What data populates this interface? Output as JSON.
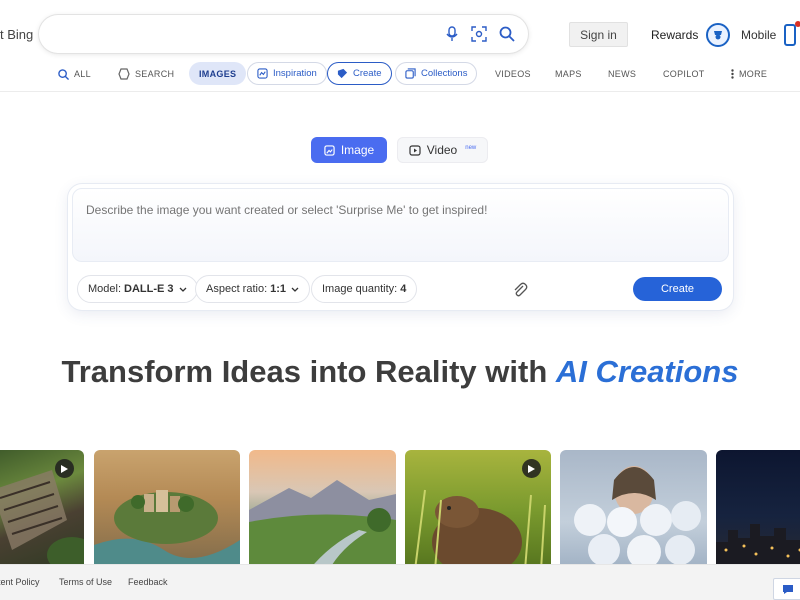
{
  "header": {
    "brand_text": "t Bing",
    "search": {
      "value": "",
      "placeholder": ""
    },
    "signin_label": "Sign in",
    "rewards_label": "Rewards",
    "mobile_label": "Mobile"
  },
  "nav": {
    "items": [
      {
        "label": "ALL",
        "icon": "search-icon"
      },
      {
        "label": "SEARCH",
        "icon": "copilot-search-icon"
      },
      {
        "label": "IMAGES",
        "active": true
      },
      {
        "label": "Inspiration",
        "icon": "inspiration-icon"
      },
      {
        "label": "Create",
        "icon": "create-icon"
      },
      {
        "label": "Collections",
        "icon": "collections-icon"
      },
      {
        "label": "VIDEOS"
      },
      {
        "label": "MAPS"
      },
      {
        "label": "NEWS"
      },
      {
        "label": "COPILOT"
      },
      {
        "label": "MORE",
        "icon": "more-vertical-icon"
      }
    ]
  },
  "mode_toggle": {
    "image_label": "Image",
    "video_label": "Video",
    "video_badge": "new",
    "selected": "Image"
  },
  "prompt": {
    "placeholder": "Describe the image you want created or select 'Surprise Me' to get inspired!",
    "value": "",
    "model_label": "Model:",
    "model_value": "DALL-E 3",
    "aspect_label": "Aspect ratio:",
    "aspect_value": "1:1",
    "quantity_label": "Image quantity:",
    "quantity_value": "4",
    "create_label": "Create"
  },
  "hero": {
    "text": "Transform Ideas into Reality with",
    "accent": "AI Creations"
  },
  "gallery": {
    "tiles": [
      {
        "subject": "wooden-structure-in-forest",
        "video": true
      },
      {
        "subject": "miniature-island-city",
        "video": false
      },
      {
        "subject": "mountain-valley-river",
        "video": false
      },
      {
        "subject": "capybara-in-grass",
        "video": true
      },
      {
        "subject": "woman-in-white-flowers",
        "video": false
      },
      {
        "subject": "city-at-night",
        "video": false
      }
    ]
  },
  "footer": {
    "links": [
      "tent Policy",
      "Terms of Use",
      "Feedback"
    ]
  },
  "colors": {
    "accent_blue": "#2663d8",
    "toggle_blue": "#4a6cf0",
    "hero_accent": "#2b6fd6"
  }
}
